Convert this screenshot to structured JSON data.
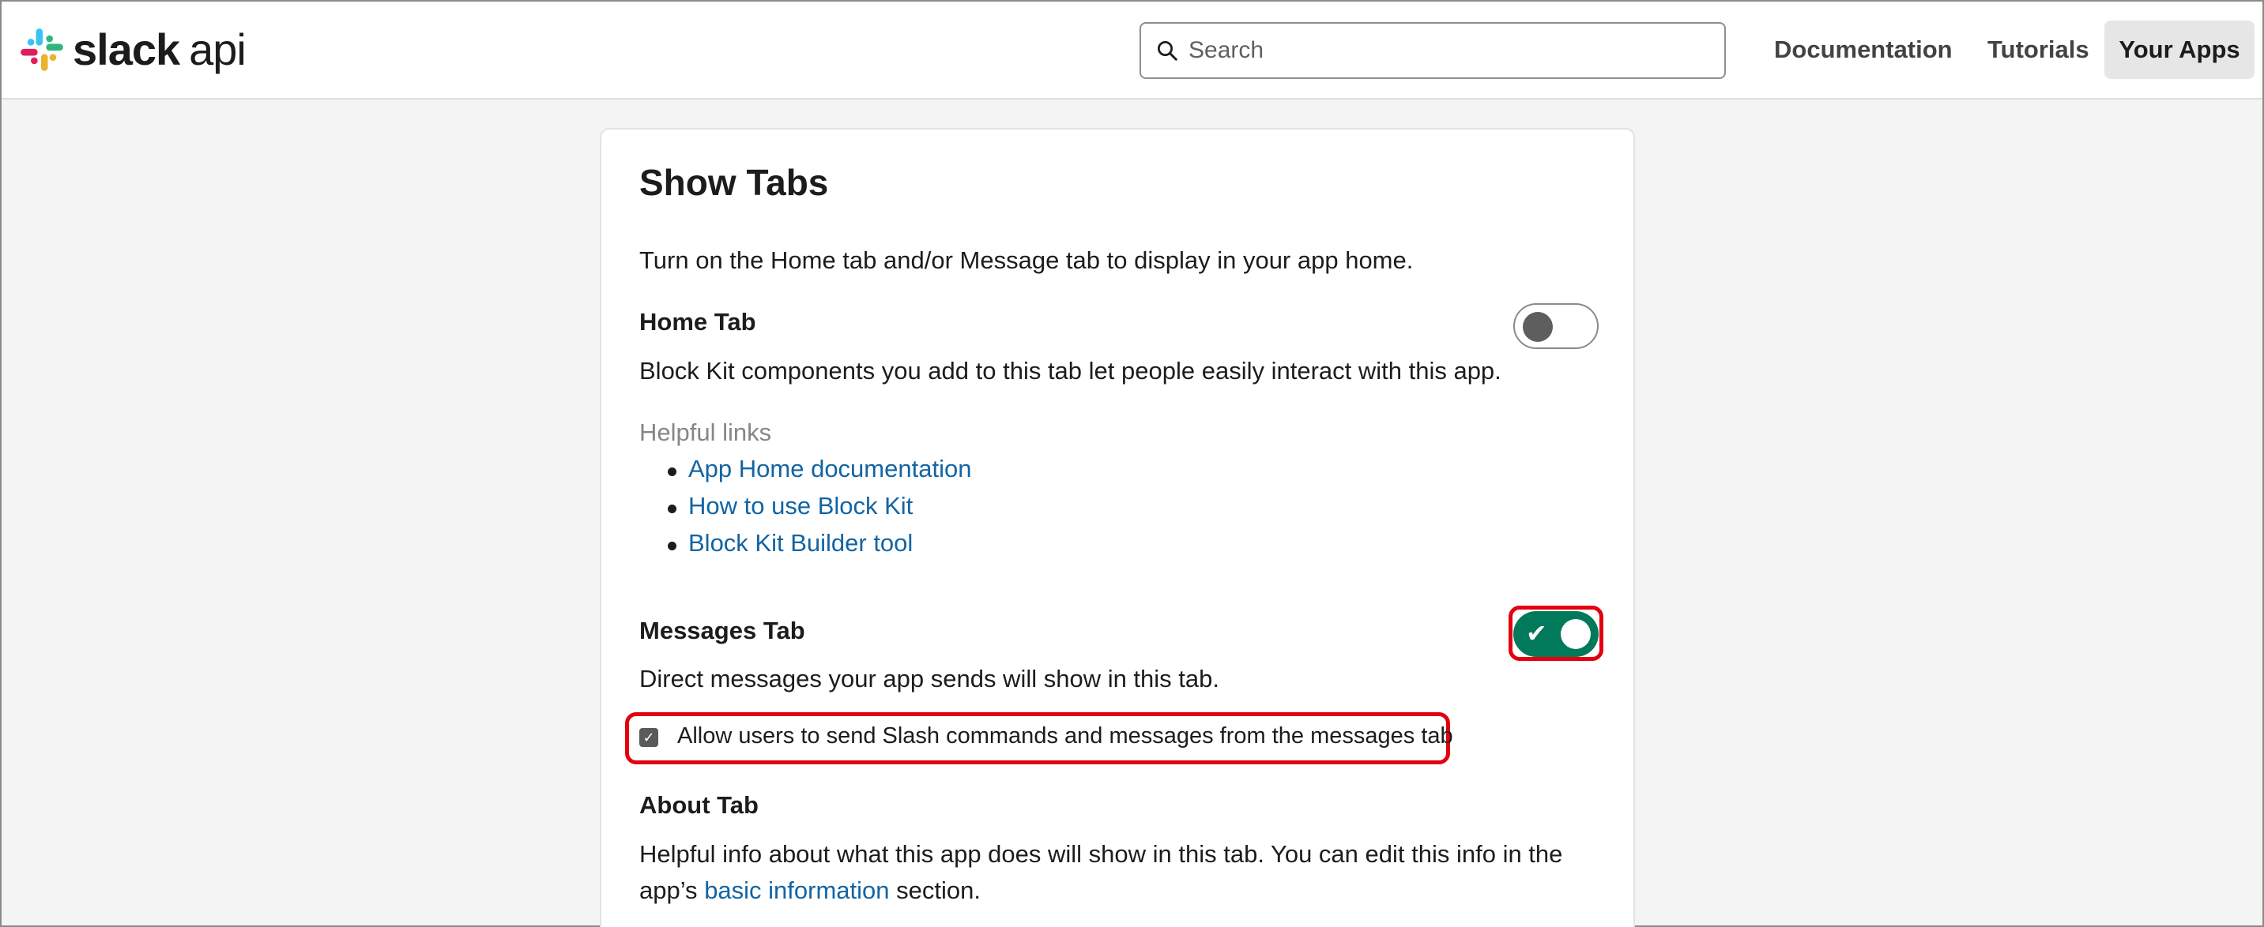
{
  "header": {
    "logo_brand": "slack",
    "logo_suffix": "api",
    "search": {
      "placeholder": "Search",
      "value": ""
    },
    "nav": {
      "documentation": "Documentation",
      "tutorials": "Tutorials",
      "your_apps": "Your Apps"
    }
  },
  "show_tabs": {
    "title": "Show Tabs",
    "intro": "Turn on the Home tab and/or Message tab to display in your app home.",
    "home_tab": {
      "label": "Home Tab",
      "enabled": false,
      "description": "Block Kit components you add to this tab let people easily interact with this app.",
      "helpful_links_label": "Helpful links",
      "links": [
        "App Home documentation",
        "How to use Block Kit",
        "Block Kit Builder tool"
      ]
    },
    "messages_tab": {
      "label": "Messages Tab",
      "enabled": true,
      "description": "Direct messages your app sends will show in this tab.",
      "allow_slash_checkbox": {
        "label": "Allow users to send Slash commands and messages from the messages tab",
        "checked": true
      }
    },
    "about_tab": {
      "label": "About Tab",
      "description_line1": "Helpful info about what this app does will show in this tab. You can edit this info in the",
      "description_line2_prefix": "app’s",
      "description_link": "basic information",
      "description_line2_suffix": "section."
    }
  },
  "colors": {
    "toggle_on": "#007a5a",
    "link": "#1264a3",
    "highlight": "#e3000f",
    "slack_blue": "#36c5f0",
    "slack_green": "#2eb67d",
    "slack_yellow": "#ecb22e",
    "slack_red": "#e01e5a"
  },
  "icons": {
    "logo": "slack-hash-logo",
    "search": "magnifier",
    "toggle_on_mark": "check",
    "checkbox_mark": "check"
  }
}
